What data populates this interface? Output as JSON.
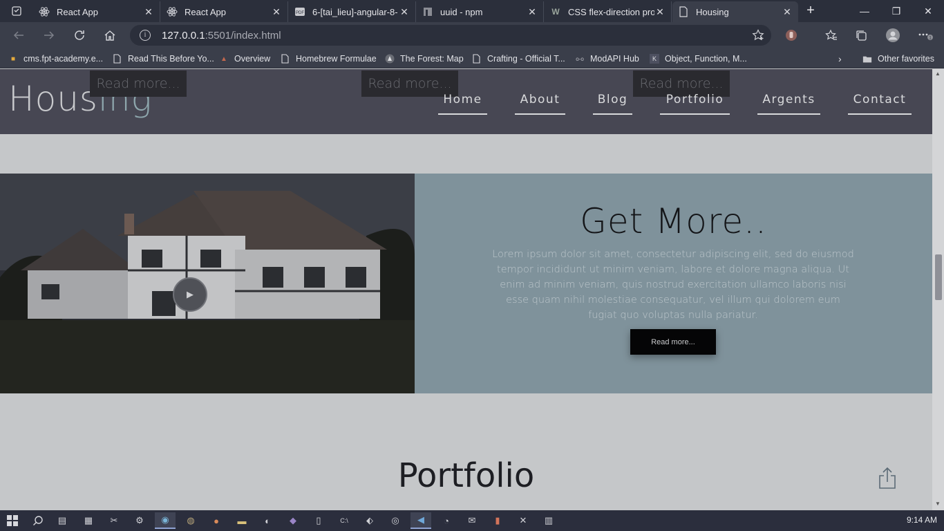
{
  "browser": {
    "tabs": [
      {
        "title": "React App",
        "icon": "react-icon"
      },
      {
        "title": "React App",
        "icon": "react-icon"
      },
      {
        "title": "6-[tai_lieu]-angular-8-",
        "icon": "pdf-icon"
      },
      {
        "title": "uuid - npm",
        "icon": "npm-icon"
      },
      {
        "title": "CSS flex-direction prop",
        "icon": "w3schools-icon"
      },
      {
        "title": "Housing",
        "icon": "page-icon"
      }
    ],
    "address": {
      "host": "127.0.0.1",
      "path": ":5501/index.html"
    },
    "bookmarks": [
      {
        "label": "cms.fpt-academy.e..."
      },
      {
        "label": "Read This Before Yo..."
      },
      {
        "label": "Overview"
      },
      {
        "label": "Homebrew Formulae"
      },
      {
        "label": "The Forest: Map"
      },
      {
        "label": "Crafting - Official T..."
      },
      {
        "label": "ModAPI Hub"
      },
      {
        "label": "Object, Function, M..."
      }
    ],
    "other_favorites": "Other favorites"
  },
  "site": {
    "logo_main": "Hous",
    "logo_accent": "ing",
    "ghost_buttons": [
      "Read more...",
      "Read more...",
      "Read more..."
    ],
    "nav": [
      "Home",
      "About",
      "Blog",
      "Portfolio",
      "Argents",
      "Contact"
    ],
    "feature": {
      "title": "Get More..",
      "body": "Lorem ipsum dolor sit amet, consectetur adipiscing elit, sed do eiusmod tempor incididunt ut minim veniam, labore et dolore magna aliqua. Ut enim ad minim veniam, quis nostrud exercitation ullamco laboris nisi esse quam nihil molestiae consequatur, vel illum qui dolorem eum fugiat quo voluptas nulla pariatur.",
      "button": "Read more..."
    },
    "section_title": "Portfolio"
  },
  "taskbar": {
    "clock": "9:14 AM"
  },
  "colors": {
    "header_bg": "#474753",
    "logo_accent": "#8ea7ad",
    "feature_panel": "#7f929b",
    "page_bg": "#c5c7c9"
  }
}
